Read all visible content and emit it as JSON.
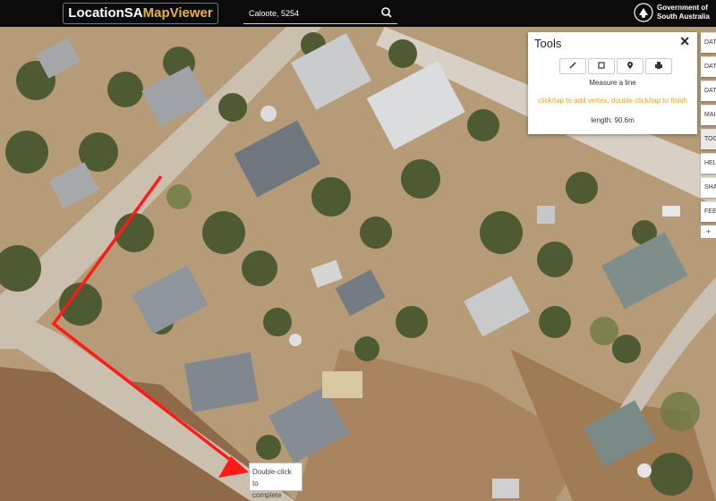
{
  "app": {
    "logo_part1": "LocationSA",
    "logo_part2": "MapViewer"
  },
  "search": {
    "value": "Caloote, 5254",
    "icon": "search-icon"
  },
  "gov": {
    "line1": "Government of",
    "line2": "South Australia",
    "icon": "crest-icon"
  },
  "tools": {
    "title": "Tools",
    "close": "✕",
    "buttons": [
      "pencil-icon",
      "square-icon",
      "pin-icon",
      "print-icon"
    ],
    "mode": "Measure a line",
    "hint": "click/tap to add vertex, double click/tap to finish",
    "length": "length: 90.6m"
  },
  "side_tabs": [
    "DAT",
    "DAT",
    "DAT",
    "MAI",
    "TOO",
    "HEL",
    "SHA",
    "FEE"
  ],
  "side_extra": "+",
  "tooltip": {
    "line1": "Double-click to",
    "line2": "complete"
  },
  "colors": {
    "topbar": "#0b0b0b",
    "accent": "#e4b53c",
    "measure_line": "#ff1a1a",
    "hint": "#e8a02a"
  }
}
